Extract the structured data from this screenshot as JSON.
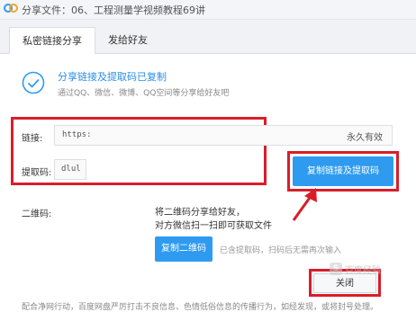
{
  "window": {
    "title": "分享文件：06、工程测量学视频教程69讲"
  },
  "tabs": [
    {
      "label": "私密链接分享",
      "active": true
    },
    {
      "label": "发给好友",
      "active": false
    }
  ],
  "status": {
    "title": "分享链接及提取码已复制",
    "subtitle": "通过QQ、微信、微博、QQ空间等分享给好友吧"
  },
  "link": {
    "label": "链接:",
    "value": "https:",
    "expiry": "永久有效"
  },
  "extract_code": {
    "label": "提取码:",
    "value": "dlul"
  },
  "buttons": {
    "copy_link_and_code": "复制链接及提取码",
    "copy_qr": "复制二维码",
    "close": "关闭"
  },
  "qr": {
    "label": "二维码:",
    "hint_line1": "将二维码分享给好友，",
    "hint_line2": "对方微信扫一扫即可获取文件",
    "note": "已含提取码，扫码后无需再次输入"
  },
  "footer": {
    "text": "配合净网行动，百度网盘严厉打击不良信息、色情低俗信息的传播行为，如经发现，或将封号处理。"
  },
  "watermark": {
    "badge": "S",
    "text": "百度经验"
  },
  "colors": {
    "accent": "#2f9bf0",
    "annotation_red": "#d81e2a",
    "success_blue": "#2a8ee6"
  }
}
